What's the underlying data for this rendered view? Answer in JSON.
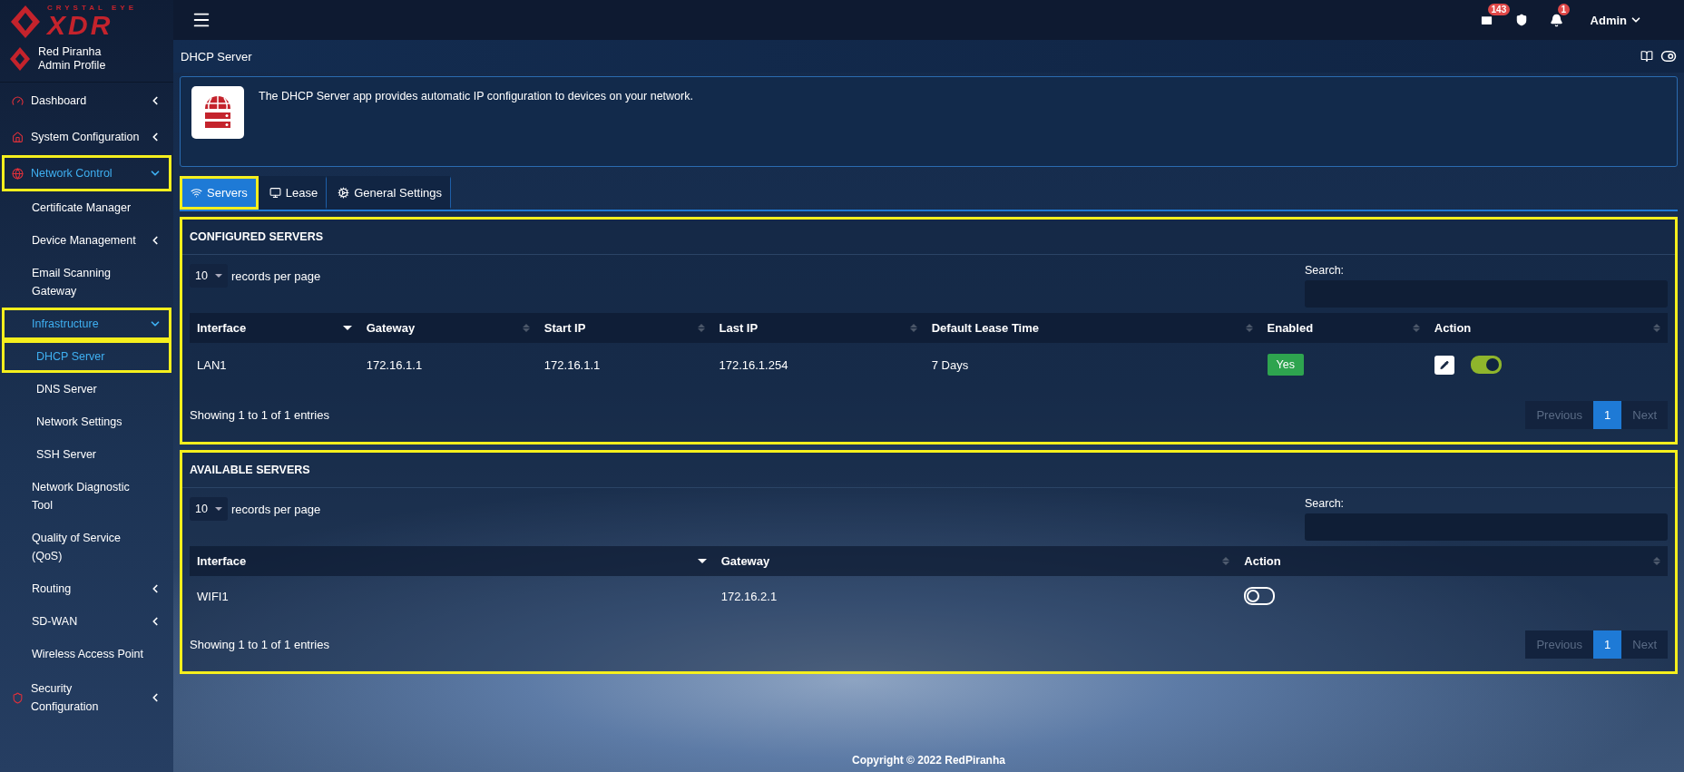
{
  "brand": {
    "tagline": "CRYSTAL EYE",
    "name": "XDR"
  },
  "profile": {
    "name": "Red Piranha",
    "role": "Admin Profile"
  },
  "sidebar": {
    "items": [
      {
        "label": "Dashboard",
        "expanded": false,
        "active": false,
        "highlighted": false
      },
      {
        "label": "System Configuration",
        "expanded": false,
        "active": false,
        "highlighted": false
      },
      {
        "label": "Network Control",
        "expanded": true,
        "active": true,
        "highlighted": true,
        "children": [
          {
            "label": "Certificate Manager",
            "active": false,
            "highlighted": false
          },
          {
            "label": "Device Management",
            "expanded": false,
            "active": false,
            "highlighted": false
          },
          {
            "label": "Email Scanning Gateway",
            "active": false,
            "highlighted": false
          },
          {
            "label": "Infrastructure",
            "expanded": true,
            "active": true,
            "highlighted": true,
            "children": [
              {
                "label": "DHCP Server",
                "active": true,
                "highlighted": true
              },
              {
                "label": "DNS Server",
                "active": false,
                "highlighted": false
              },
              {
                "label": "Network Settings",
                "active": false,
                "highlighted": false
              },
              {
                "label": "SSH Server",
                "active": false,
                "highlighted": false
              }
            ]
          },
          {
            "label": "Network Diagnostic Tool",
            "active": false,
            "highlighted": false
          },
          {
            "label": "Quality of Service (QoS)",
            "active": false,
            "highlighted": false
          },
          {
            "label": "Routing",
            "expanded": false,
            "active": false,
            "highlighted": false
          },
          {
            "label": "SD-WAN",
            "expanded": false,
            "active": false,
            "highlighted": false
          },
          {
            "label": "Wireless Access Point",
            "active": false,
            "highlighted": false
          }
        ]
      },
      {
        "label": "Security Configuration",
        "expanded": false,
        "active": false,
        "highlighted": false
      }
    ]
  },
  "topbar": {
    "mail_count": "143",
    "alert_count": "1",
    "user": "Admin"
  },
  "page": {
    "title": "DHCP Server",
    "description": "The DHCP Server app provides automatic IP configuration to devices on your network."
  },
  "tabs": [
    {
      "label": "Servers",
      "selected": true,
      "highlighted": true
    },
    {
      "label": "Lease",
      "selected": false,
      "highlighted": false
    },
    {
      "label": "General Settings",
      "selected": false,
      "highlighted": false
    }
  ],
  "panels": [
    {
      "title": "CONFIGURED SERVERS",
      "highlighted": true,
      "page_size": "10",
      "page_size_label": "records per page",
      "search_label": "Search:",
      "columns": [
        {
          "label": "Interface",
          "sorted": true
        },
        {
          "label": "Gateway",
          "sorted": false
        },
        {
          "label": "Start IP",
          "sorted": false
        },
        {
          "label": "Last IP",
          "sorted": false
        },
        {
          "label": "Default Lease Time",
          "sorted": false
        },
        {
          "label": "Enabled",
          "sorted": false
        },
        {
          "label": "Action",
          "sorted": false
        }
      ],
      "rows": [
        {
          "cells": [
            {
              "kind": "text",
              "text": "LAN1"
            },
            {
              "kind": "text",
              "text": "172.16.1.1"
            },
            {
              "kind": "text",
              "text": "172.16.1.1"
            },
            {
              "kind": "text",
              "text": "172.16.1.254"
            },
            {
              "kind": "text",
              "text": "7 Days"
            },
            {
              "kind": "badge",
              "text": "Yes"
            },
            {
              "kind": "actions",
              "editable": true,
              "on": true
            }
          ]
        }
      ],
      "info": "Showing 1 to 1 of 1 entries",
      "pager": {
        "previous": "Previous",
        "pages": [
          {
            "label": "1",
            "selected": true
          }
        ],
        "next": "Next"
      }
    },
    {
      "title": "AVAILABLE SERVERS",
      "highlighted": true,
      "page_size": "10",
      "page_size_label": "records per page",
      "search_label": "Search:",
      "columns": [
        {
          "label": "Interface",
          "sorted": true
        },
        {
          "label": "Gateway",
          "sorted": false
        },
        {
          "label": "Action",
          "sorted": false
        }
      ],
      "rows": [
        {
          "cells": [
            {
              "kind": "text",
              "text": "WIFI1"
            },
            {
              "kind": "text",
              "text": "172.16.2.1"
            },
            {
              "kind": "actions",
              "editable": false,
              "on": false
            }
          ]
        }
      ],
      "info": "Showing 1 to 1 of 1 entries",
      "pager": {
        "previous": "Previous",
        "pages": [
          {
            "label": "1",
            "selected": true
          }
        ],
        "next": "Next"
      }
    }
  ],
  "footer": "Copyright © 2022 RedPiranha"
}
